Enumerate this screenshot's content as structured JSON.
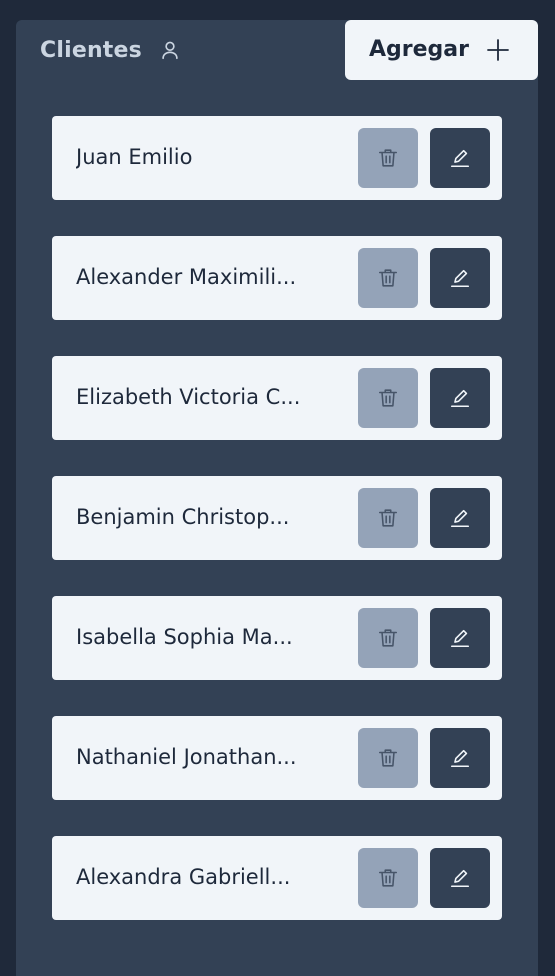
{
  "header": {
    "title": "Clientes",
    "add_label": "Agregar"
  },
  "icons": {
    "title_icon": "user-icon",
    "add_icon": "plus-icon",
    "delete_icon": "trash-icon",
    "edit_icon": "pencil-icon"
  },
  "colors": {
    "background": "#1f293a",
    "panel": "#334155",
    "card": "#f1f5f9",
    "delete_button": "#94a3b8",
    "edit_button": "#334155"
  },
  "clients": [
    {
      "name": "Juan Emilio"
    },
    {
      "name": "Alexander Maximili..."
    },
    {
      "name": "Elizabeth Victoria C..."
    },
    {
      "name": "Benjamin Christop..."
    },
    {
      "name": "Isabella Sophia Ma..."
    },
    {
      "name": "Nathaniel Jonathan..."
    },
    {
      "name": "Alexandra Gabriell..."
    }
  ]
}
